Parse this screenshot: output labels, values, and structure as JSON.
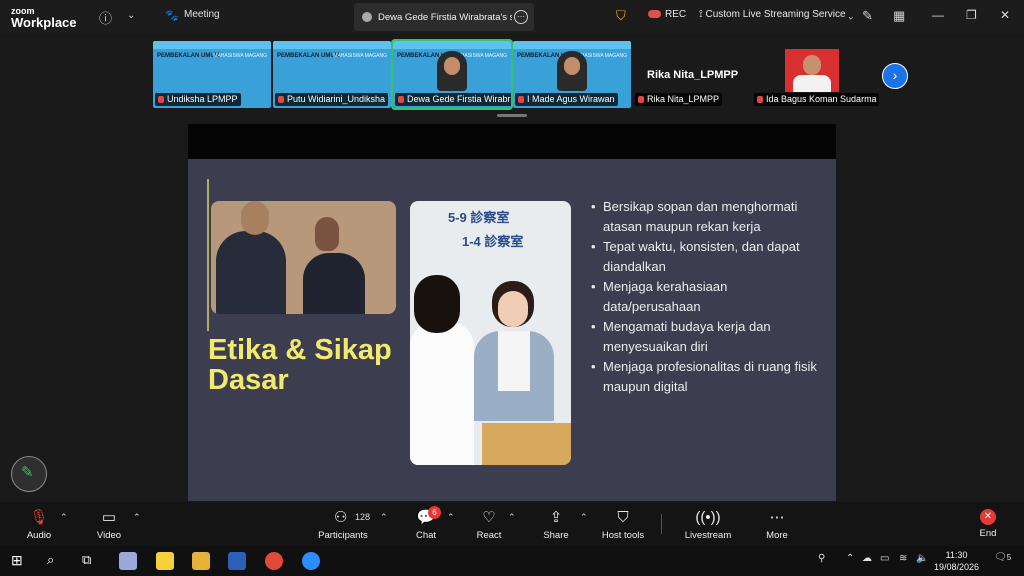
{
  "app": {
    "logo_top": "zoom",
    "logo_bottom": "Workplace"
  },
  "titlebar": {
    "meeting_label": "Meeting",
    "share_tab_label": "Dewa Gede Firstia Wirabrata's screen",
    "rec_label": "REC",
    "stream_label": "Custom Live Streaming Service"
  },
  "participants": [
    {
      "name": "Undiksha LPMPP"
    },
    {
      "name": "Putu Widiarini_Undiksha"
    },
    {
      "name": "Dewa Gede Firstia Wirabrata"
    },
    {
      "name": "I Made Agus Wirawan"
    },
    {
      "name": "Rika Nita_LPMPP"
    },
    {
      "name": "Ida Bagus Koman Sudarma"
    }
  ],
  "thumb_slide": {
    "title": "PEMBEKALAN UMUM",
    "subtitle": "MAHASISWA MAGANG"
  },
  "slide": {
    "title_line1": "Etika & Sikap",
    "title_line2": "Dasar",
    "sign_line1": "5-9 診察室",
    "sign_line2": "1-4 診察室",
    "bullets": [
      "Bersikap sopan dan menghormati atasan maupun rekan kerja",
      "Tepat waktu, konsisten, dan dapat diandalkan",
      "Menjaga kerahasiaan data/perusahaan",
      "Mengamati budaya kerja dan menyesuaikan diri",
      "Menjaga profesionalitas di ruang fisik maupun digital"
    ]
  },
  "toolbar": {
    "audio": "Audio",
    "video": "Video",
    "participants": "Participants",
    "participants_count": "128",
    "chat": "Chat",
    "chat_badge": "6",
    "react": "React",
    "share": "Share",
    "host_tools": "Host tools",
    "livestream": "Livestream",
    "more": "More",
    "end": "End"
  },
  "taskbar": {
    "time": "11:30",
    "date": "19/08/2026",
    "notification_count": "5"
  },
  "colors": {
    "accent_green": "#37c06a",
    "slide_title": "#f3ea6c",
    "end_red": "#e53935"
  }
}
